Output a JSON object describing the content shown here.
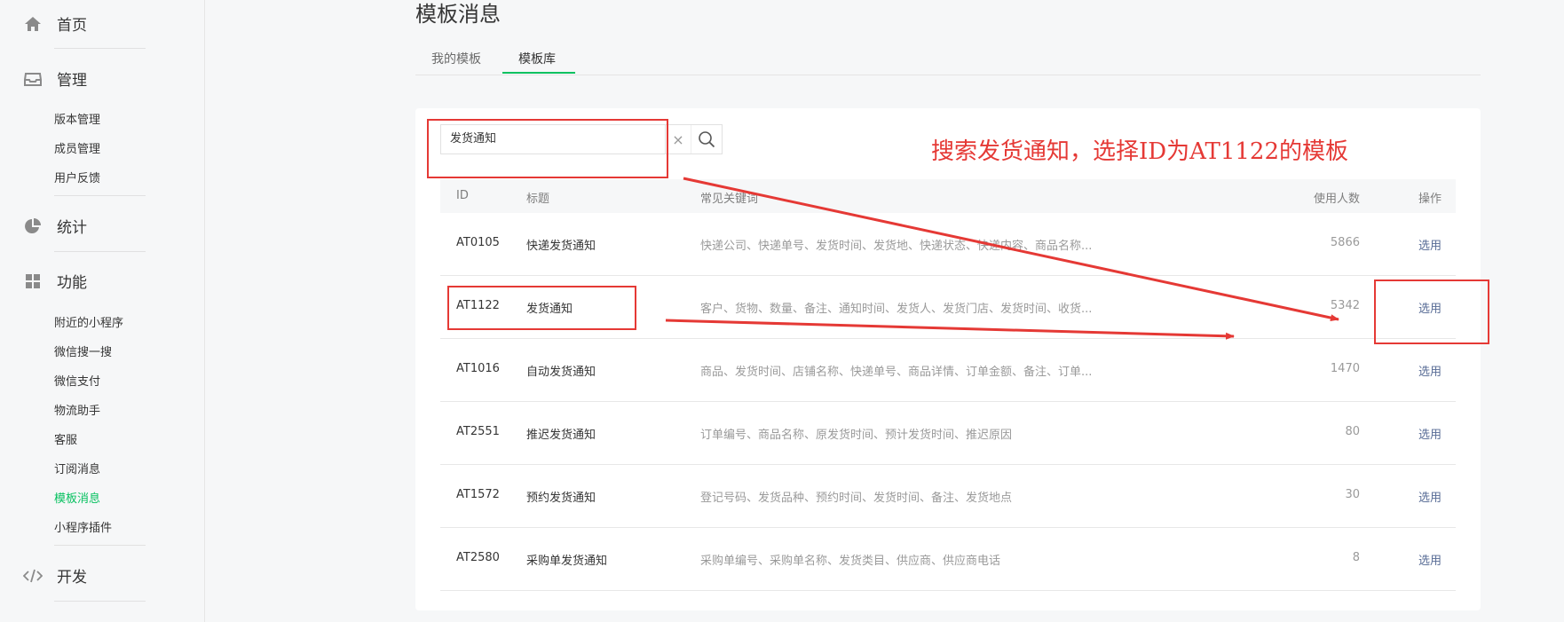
{
  "sidebar": {
    "home": {
      "label": "首页",
      "icon": "home-icon"
    },
    "manage": {
      "label": "管理",
      "icon": "inbox-icon",
      "items": [
        "版本管理",
        "成员管理",
        "用户反馈"
      ]
    },
    "stats": {
      "label": "统计",
      "icon": "pie-chart-icon"
    },
    "features": {
      "label": "功能",
      "icon": "grid-icon",
      "items": [
        "附近的小程序",
        "微信搜一搜",
        "微信支付",
        "物流助手",
        "客服",
        "订阅消息",
        "模板消息",
        "小程序插件"
      ],
      "active_item": "模板消息"
    },
    "dev": {
      "label": "开发",
      "icon": "code-icon"
    }
  },
  "page": {
    "title": "模板消息",
    "tabs": [
      "我的模板",
      "模板库"
    ],
    "active_tab": "模板库"
  },
  "search": {
    "value": "发货通知",
    "clear_icon": "×"
  },
  "table": {
    "headers": {
      "id": "ID",
      "title": "标题",
      "keywords": "常见关键词",
      "users": "使用人数",
      "op": "操作"
    },
    "rows": [
      {
        "id": "AT0105",
        "title": "快递发货通知",
        "keywords": "快递公司、快递单号、发货时间、发货地、快递状态、快递内容、商品名称...",
        "users": "5866",
        "op": "选用"
      },
      {
        "id": "AT1122",
        "title": "发货通知",
        "keywords": "客户、货物、数量、备注、通知时间、发货人、发货门店、发货时间、收货...",
        "users": "5342",
        "op": "选用"
      },
      {
        "id": "AT1016",
        "title": "自动发货通知",
        "keywords": "商品、发货时间、店铺名称、快递单号、商品详情、订单金额、备注、订单...",
        "users": "1470",
        "op": "选用"
      },
      {
        "id": "AT2551",
        "title": "推迟发货通知",
        "keywords": "订单编号、商品名称、原发货时间、预计发货时间、推迟原因",
        "users": "80",
        "op": "选用"
      },
      {
        "id": "AT1572",
        "title": "预约发货通知",
        "keywords": "登记号码、发货品种、预约时间、发货时间、备注、发货地点",
        "users": "30",
        "op": "选用"
      },
      {
        "id": "AT2580",
        "title": "采购单发货通知",
        "keywords": "采购单编号、采购单名称、发货类目、供应商、供应商电话",
        "users": "8",
        "op": "选用"
      }
    ]
  },
  "annotation": {
    "text": "搜索发货通知，选择ID为AT1122的模板",
    "color": "#e53935"
  },
  "colors": {
    "accent": "#07c160",
    "link": "#576b95"
  }
}
